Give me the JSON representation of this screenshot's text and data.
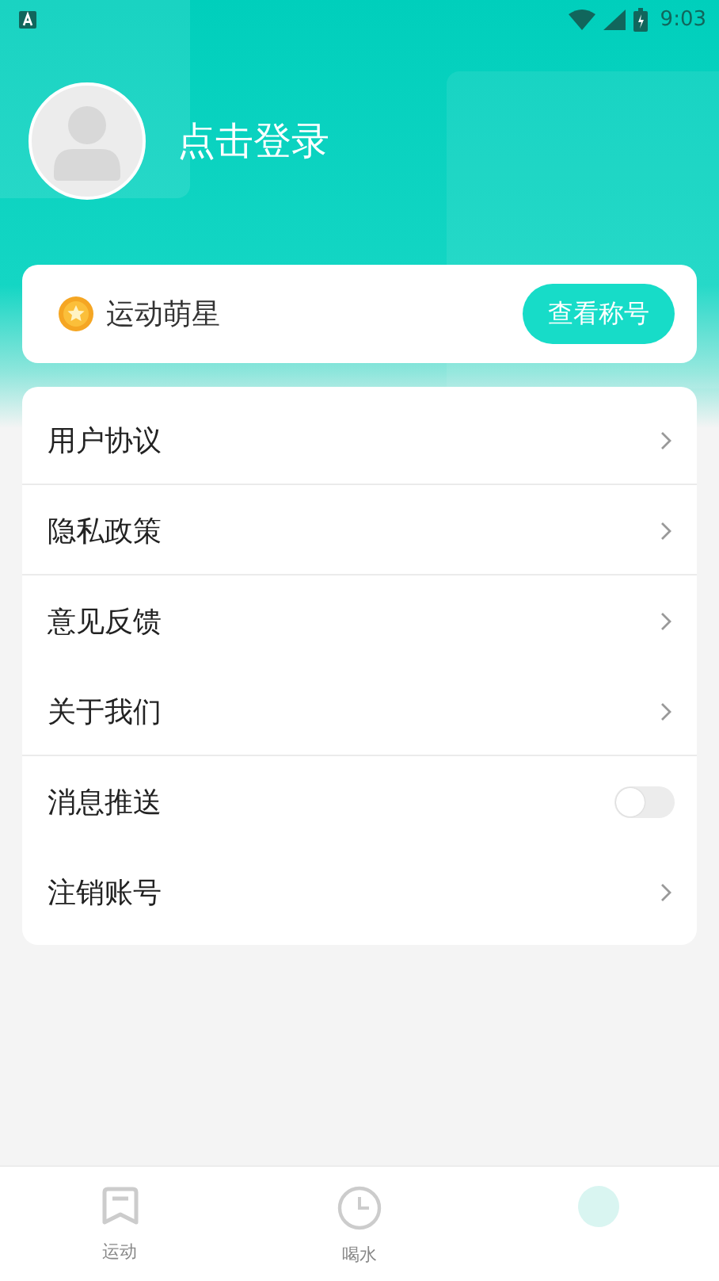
{
  "status_bar": {
    "time": "9:03"
  },
  "profile": {
    "login_text": "点击登录"
  },
  "title_card": {
    "title": "运动萌星",
    "button": "查看称号"
  },
  "menu": [
    {
      "kind": "link",
      "label": "用户协议",
      "divider": true
    },
    {
      "kind": "link",
      "label": "隐私政策",
      "divider": true
    },
    {
      "kind": "link",
      "label": "意见反馈",
      "divider": false
    },
    {
      "kind": "link",
      "label": "关于我们",
      "divider": true
    },
    {
      "kind": "toggle",
      "label": "消息推送",
      "on": false,
      "divider": false
    },
    {
      "kind": "link",
      "label": "注销账号",
      "divider": false
    }
  ],
  "bottom_nav": [
    {
      "kind": "sport",
      "label": "运动",
      "selected": false
    },
    {
      "kind": "water",
      "label": "喝水",
      "selected": false
    },
    {
      "kind": "mine",
      "selected": true
    }
  ]
}
